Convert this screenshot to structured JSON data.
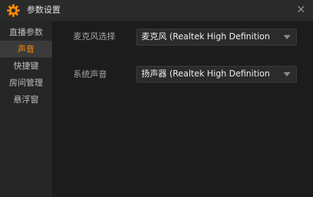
{
  "window": {
    "title": "参数设置",
    "icon": "gear-icon",
    "close_icon": "close-icon"
  },
  "sidebar": {
    "items": [
      {
        "label": "直播参数",
        "active": false
      },
      {
        "label": "声音",
        "active": true
      },
      {
        "label": "快捷键",
        "active": false
      },
      {
        "label": "房间管理",
        "active": false
      },
      {
        "label": "悬浮窗",
        "active": false
      }
    ]
  },
  "settings": {
    "microphone": {
      "label": "麦克风选择",
      "value": "麦克风 (Realtek High Definition"
    },
    "system_sound": {
      "label": "系统声音",
      "value": "扬声器 (Realtek High Definition"
    }
  },
  "colors": {
    "accent": "#ff8a00",
    "background": "#1c1c1c",
    "sidebar": "#262626",
    "titlebar": "#2a2a2a"
  }
}
